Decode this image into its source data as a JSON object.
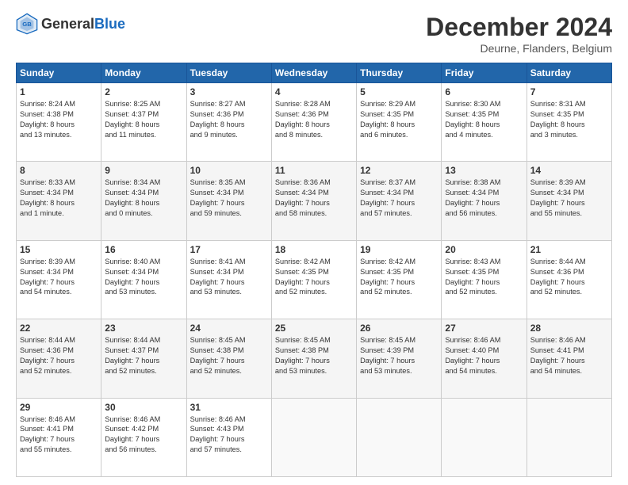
{
  "header": {
    "logo_general": "General",
    "logo_blue": "Blue",
    "month_title": "December 2024",
    "location": "Deurne, Flanders, Belgium"
  },
  "weekdays": [
    "Sunday",
    "Monday",
    "Tuesday",
    "Wednesday",
    "Thursday",
    "Friday",
    "Saturday"
  ],
  "weeks": [
    [
      {
        "day": "1",
        "info": "Sunrise: 8:24 AM\nSunset: 4:38 PM\nDaylight: 8 hours\nand 13 minutes."
      },
      {
        "day": "2",
        "info": "Sunrise: 8:25 AM\nSunset: 4:37 PM\nDaylight: 8 hours\nand 11 minutes."
      },
      {
        "day": "3",
        "info": "Sunrise: 8:27 AM\nSunset: 4:36 PM\nDaylight: 8 hours\nand 9 minutes."
      },
      {
        "day": "4",
        "info": "Sunrise: 8:28 AM\nSunset: 4:36 PM\nDaylight: 8 hours\nand 8 minutes."
      },
      {
        "day": "5",
        "info": "Sunrise: 8:29 AM\nSunset: 4:35 PM\nDaylight: 8 hours\nand 6 minutes."
      },
      {
        "day": "6",
        "info": "Sunrise: 8:30 AM\nSunset: 4:35 PM\nDaylight: 8 hours\nand 4 minutes."
      },
      {
        "day": "7",
        "info": "Sunrise: 8:31 AM\nSunset: 4:35 PM\nDaylight: 8 hours\nand 3 minutes."
      }
    ],
    [
      {
        "day": "8",
        "info": "Sunrise: 8:33 AM\nSunset: 4:34 PM\nDaylight: 8 hours\nand 1 minute."
      },
      {
        "day": "9",
        "info": "Sunrise: 8:34 AM\nSunset: 4:34 PM\nDaylight: 8 hours\nand 0 minutes."
      },
      {
        "day": "10",
        "info": "Sunrise: 8:35 AM\nSunset: 4:34 PM\nDaylight: 7 hours\nand 59 minutes."
      },
      {
        "day": "11",
        "info": "Sunrise: 8:36 AM\nSunset: 4:34 PM\nDaylight: 7 hours\nand 58 minutes."
      },
      {
        "day": "12",
        "info": "Sunrise: 8:37 AM\nSunset: 4:34 PM\nDaylight: 7 hours\nand 57 minutes."
      },
      {
        "day": "13",
        "info": "Sunrise: 8:38 AM\nSunset: 4:34 PM\nDaylight: 7 hours\nand 56 minutes."
      },
      {
        "day": "14",
        "info": "Sunrise: 8:39 AM\nSunset: 4:34 PM\nDaylight: 7 hours\nand 55 minutes."
      }
    ],
    [
      {
        "day": "15",
        "info": "Sunrise: 8:39 AM\nSunset: 4:34 PM\nDaylight: 7 hours\nand 54 minutes."
      },
      {
        "day": "16",
        "info": "Sunrise: 8:40 AM\nSunset: 4:34 PM\nDaylight: 7 hours\nand 53 minutes."
      },
      {
        "day": "17",
        "info": "Sunrise: 8:41 AM\nSunset: 4:34 PM\nDaylight: 7 hours\nand 53 minutes."
      },
      {
        "day": "18",
        "info": "Sunrise: 8:42 AM\nSunset: 4:35 PM\nDaylight: 7 hours\nand 52 minutes."
      },
      {
        "day": "19",
        "info": "Sunrise: 8:42 AM\nSunset: 4:35 PM\nDaylight: 7 hours\nand 52 minutes."
      },
      {
        "day": "20",
        "info": "Sunrise: 8:43 AM\nSunset: 4:35 PM\nDaylight: 7 hours\nand 52 minutes."
      },
      {
        "day": "21",
        "info": "Sunrise: 8:44 AM\nSunset: 4:36 PM\nDaylight: 7 hours\nand 52 minutes."
      }
    ],
    [
      {
        "day": "22",
        "info": "Sunrise: 8:44 AM\nSunset: 4:36 PM\nDaylight: 7 hours\nand 52 minutes."
      },
      {
        "day": "23",
        "info": "Sunrise: 8:44 AM\nSunset: 4:37 PM\nDaylight: 7 hours\nand 52 minutes."
      },
      {
        "day": "24",
        "info": "Sunrise: 8:45 AM\nSunset: 4:38 PM\nDaylight: 7 hours\nand 52 minutes."
      },
      {
        "day": "25",
        "info": "Sunrise: 8:45 AM\nSunset: 4:38 PM\nDaylight: 7 hours\nand 53 minutes."
      },
      {
        "day": "26",
        "info": "Sunrise: 8:45 AM\nSunset: 4:39 PM\nDaylight: 7 hours\nand 53 minutes."
      },
      {
        "day": "27",
        "info": "Sunrise: 8:46 AM\nSunset: 4:40 PM\nDaylight: 7 hours\nand 54 minutes."
      },
      {
        "day": "28",
        "info": "Sunrise: 8:46 AM\nSunset: 4:41 PM\nDaylight: 7 hours\nand 54 minutes."
      }
    ],
    [
      {
        "day": "29",
        "info": "Sunrise: 8:46 AM\nSunset: 4:41 PM\nDaylight: 7 hours\nand 55 minutes."
      },
      {
        "day": "30",
        "info": "Sunrise: 8:46 AM\nSunset: 4:42 PM\nDaylight: 7 hours\nand 56 minutes."
      },
      {
        "day": "31",
        "info": "Sunrise: 8:46 AM\nSunset: 4:43 PM\nDaylight: 7 hours\nand 57 minutes."
      },
      {
        "day": "",
        "info": ""
      },
      {
        "day": "",
        "info": ""
      },
      {
        "day": "",
        "info": ""
      },
      {
        "day": "",
        "info": ""
      }
    ]
  ]
}
